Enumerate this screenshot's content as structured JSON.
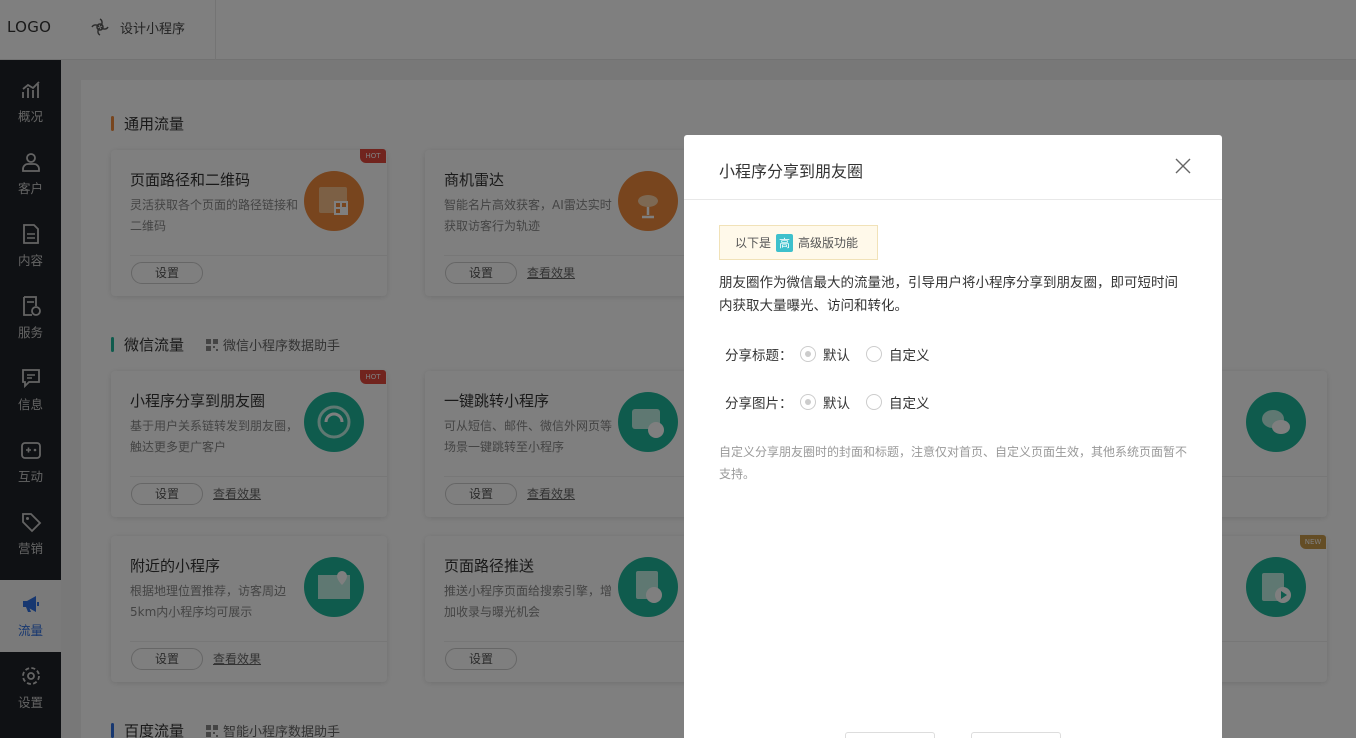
{
  "topbar": {
    "logo": "LOGO",
    "design_label": "设计小程序"
  },
  "sidebar": [
    {
      "label": "概况",
      "icon": "chart-icon"
    },
    {
      "label": "客户",
      "icon": "user-icon"
    },
    {
      "label": "内容",
      "icon": "document-icon"
    },
    {
      "label": "服务",
      "icon": "service-icon"
    },
    {
      "label": "信息",
      "icon": "message-icon"
    },
    {
      "label": "互动",
      "icon": "gamepad-icon"
    },
    {
      "label": "营销",
      "icon": "tag-icon"
    },
    {
      "label": "流量",
      "icon": "megaphone-icon",
      "active": true
    },
    {
      "label": "设置",
      "icon": "gear-icon"
    }
  ],
  "sections": {
    "general": {
      "title": "通用流量"
    },
    "wechat": {
      "title": "微信流量",
      "sub": "微信小程序数据助手"
    },
    "baidu": {
      "title": "百度流量",
      "sub": "智能小程序数据助手"
    }
  },
  "cards": {
    "c1": {
      "title": "页面路径和二维码",
      "desc": "灵活获取各个页面的路径链接和二维码",
      "btn": "设置",
      "badge": "HOT"
    },
    "c2": {
      "title": "商机雷达",
      "desc": "智能名片高效获客，AI雷达实时获取访客行为轨迹",
      "btn": "设置",
      "link": "查看效果"
    },
    "c3": {
      "title": "小程序分享到朋友圈",
      "desc": "基于用户关系链转发到朋友圈，触达更多更广客户",
      "btn": "设置",
      "link": "查看效果",
      "badge": "HOT"
    },
    "c4": {
      "title": "一键跳转小程序",
      "desc": "可从短信、邮件、微信外网页等场景一键跳转至小程序",
      "btn": "设置",
      "link": "查看效果"
    },
    "c5": {
      "title": "附近的小程序",
      "desc": "根据地理位置推荐，访客周边5km内小程序均可展示",
      "btn": "设置",
      "link": "查看效果"
    },
    "c6": {
      "title": "页面路径推送",
      "desc": "推送小程序页面给搜索引擎，增加收录与曝光机会",
      "btn": "设置"
    },
    "c7": {
      "badge": "NEW"
    }
  },
  "modal": {
    "title": "小程序分享到朋友圈",
    "tip_prefix": "以下是",
    "tip_badge": "高",
    "tip_suffix": "高级版功能",
    "description": "朋友圈作为微信最大的流量池，引导用户将小程序分享到朋友圈，即可短时间内获取大量曝光、访问和转化。",
    "share_title_label": "分享标题：",
    "share_image_label": "分享图片：",
    "option_default": "默认",
    "option_custom": "自定义",
    "note": "自定义分享朋友圈时的封面和标题，注意仅对首页、自定义页面生效，其他系统页面暂不支持。"
  },
  "colors": {
    "sidebar_bg": "#1f2328",
    "active_blue": "#2e6fe0",
    "orange": "#f08a3c",
    "teal": "#1fb79b",
    "hot_red": "#e2483d",
    "new_gold": "#c99a4b"
  }
}
